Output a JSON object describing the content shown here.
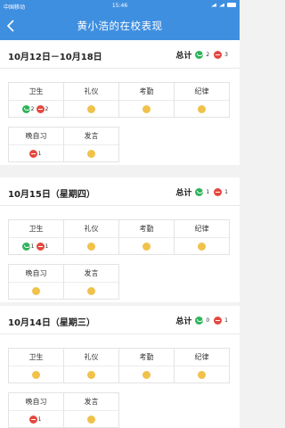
{
  "status_bar": {
    "carrier": "中国移动",
    "time": "15:46"
  },
  "nav": {
    "title": "黄小浩的在校表现"
  },
  "colors": {
    "primary": "#3f8fe0",
    "good": "#2fb35a",
    "bad": "#e4483f",
    "neutral": "#f0c24b"
  },
  "icons": {
    "back": "chevron-left-icon",
    "good": "smile-icon",
    "bad": "frown-icon",
    "neutral": "neutral-dot-icon"
  },
  "weeks": [
    {
      "date": "10月12日－10月18日",
      "total_label": "总计",
      "good_count": "2",
      "bad_count": "3",
      "categories": [
        {
          "name": "卫生",
          "good": "2",
          "bad": "2"
        },
        {
          "name": "礼仪"
        },
        {
          "name": "考勤"
        },
        {
          "name": "纪律"
        },
        {
          "name": "晚自习",
          "bad": "1"
        },
        {
          "name": "发言"
        }
      ]
    },
    {
      "date": "10月15日（星期四）",
      "total_label": "总计",
      "good_count": "1",
      "bad_count": "1",
      "categories": [
        {
          "name": "卫生",
          "good": "1",
          "bad": "1"
        },
        {
          "name": "礼仪"
        },
        {
          "name": "考勤"
        },
        {
          "name": "纪律"
        },
        {
          "name": "晚自习"
        },
        {
          "name": "发言"
        }
      ]
    },
    {
      "date": "10月14日（星期三）",
      "total_label": "总计",
      "good_count": "0",
      "bad_count": "1",
      "categories": [
        {
          "name": "卫生"
        },
        {
          "name": "礼仪"
        },
        {
          "name": "考勤"
        },
        {
          "name": "纪律"
        },
        {
          "name": "晚自习",
          "bad": "1"
        },
        {
          "name": "发言"
        }
      ]
    }
  ]
}
